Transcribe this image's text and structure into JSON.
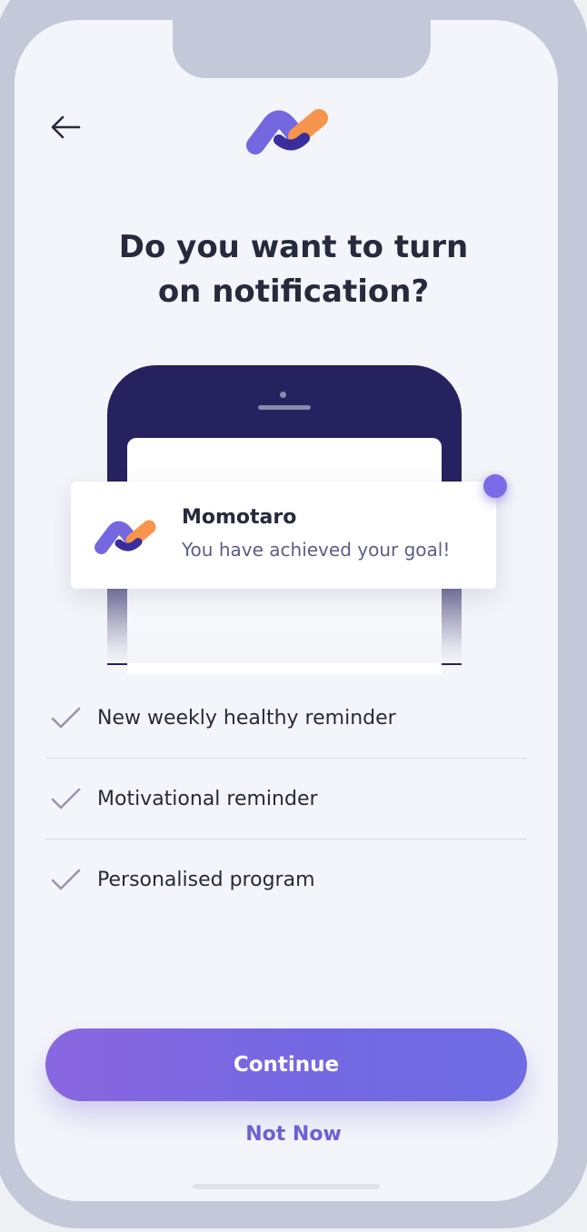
{
  "header": {
    "back_icon": "arrow-left-icon",
    "logo_icon": "momotaro-logo-icon"
  },
  "title": {
    "line1": "Do you want to turn",
    "line2": "on notification?"
  },
  "notification_preview": {
    "app_name": "Momotaro",
    "message": "You have achieved your goal!",
    "icon": "momotaro-logo-icon"
  },
  "benefits": [
    {
      "icon": "check-icon",
      "label": "New weekly healthy reminder"
    },
    {
      "icon": "check-icon",
      "label": "Motivational reminder"
    },
    {
      "icon": "check-icon",
      "label": "Personalised program"
    }
  ],
  "actions": {
    "continue_label": "Continue",
    "not_now_label": "Not Now"
  },
  "colors": {
    "primary": "#7468e2",
    "primary_gradient_start": "#8a67e0",
    "accent_orange": "#f7954e",
    "text_dark": "#252a3d",
    "text_muted": "#5b5f87",
    "device_frame": "#c3c9d9",
    "illustration_phone": "#25225f"
  }
}
